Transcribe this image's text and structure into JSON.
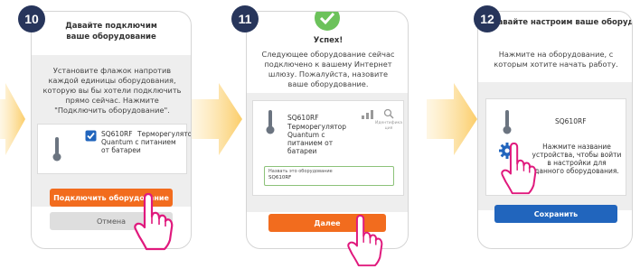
{
  "colors": {
    "orange": "#f26c1e",
    "blue": "#2165bd",
    "badge": "#27355b",
    "hand": "#e0197d",
    "arrow": "#fbcd69",
    "green": "#6cc25b"
  },
  "step10": {
    "badge": "10",
    "title": "Давайте подключим ваше оборудование",
    "desc": "Установите флажок напротив каждой единицы оборудования, которую вы бы хотели подключить прямо сейчас. Нажмите \"Подключить оборудование\".",
    "device_name": "SQ610RF",
    "device_desc": "Терморегулятор Quantum с питанием от батареи",
    "connect_label": "Подключить оборудование",
    "cancel_label": "Отмена",
    "icons": [
      "thermometer-icon",
      "checkbox-icon",
      "pointing-hand-icon"
    ]
  },
  "step11": {
    "badge": "11",
    "title": "Успех!",
    "desc": "Следующее оборудование сейчас подключено к вашему Интернет шлюзу. Пожалуйста, назовите ваше оборудование.",
    "device_name": "SQ610RF",
    "device_desc": "Терморегулятор Quantum с питанием от батареи",
    "identify_label": "Идентификация",
    "name_label": "Назвать это оборудование",
    "name_value": "SQ610RF",
    "next_label": "Далее",
    "icons": [
      "success-check-icon",
      "thermometer-icon",
      "signal-icon",
      "identify-icon",
      "pointing-hand-icon"
    ]
  },
  "step12": {
    "badge": "12",
    "title": "Давайте настроим ваше оборудование",
    "desc": "Нажмите на оборудование, с которым хотите начать работу.",
    "device_name": "SQ610RF",
    "hint": "Нажмите название устройства, чтобы войти в настройки для данного оборудования.",
    "save_label": "Сохранить",
    "icons": [
      "thermometer-icon",
      "gear-icon",
      "pointing-hand-icon"
    ]
  }
}
